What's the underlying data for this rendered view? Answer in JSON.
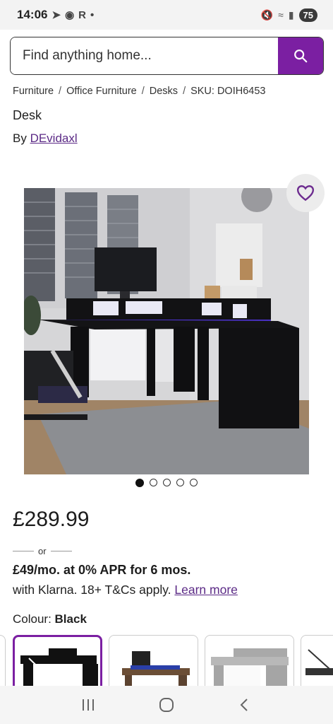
{
  "status": {
    "time": "14:06",
    "battery": "75"
  },
  "search": {
    "placeholder": "Find anything home..."
  },
  "breadcrumb": [
    "Furniture",
    "Office Furniture",
    "Desks",
    "SKU: DOIH6453"
  ],
  "product": {
    "title": "Desk",
    "by_label": "By ",
    "brand": "DEvidaxl",
    "price": "£289.99",
    "or_label": "or",
    "finance_line": "£49/mo. at 0% APR for 6 mos.",
    "klarna_text": "with Klarna. 18+ T&Cs apply. ",
    "learn_more": "Learn more",
    "colour_label": "Colour: ",
    "colour_value": "Black"
  },
  "gallery": {
    "image_count": 5,
    "active_index": 0
  },
  "colors": {
    "accent": "#7b1fa2",
    "link": "#5b2a86"
  }
}
